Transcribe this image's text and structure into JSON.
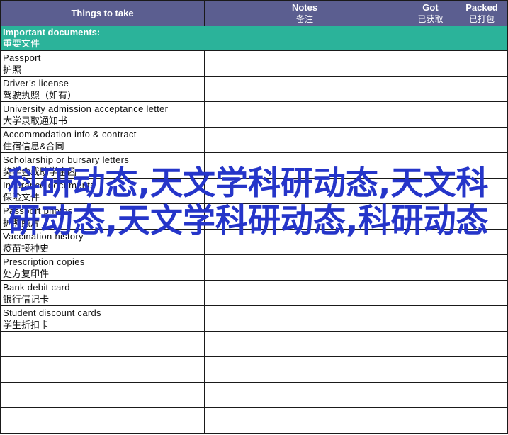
{
  "header": {
    "col1": "Things to take",
    "col2_en": "Notes",
    "col2_zh": "备注",
    "col3_en": "Got",
    "col3_zh": "已获取",
    "col4_en": "Packed",
    "col4_zh": "已打包"
  },
  "section": {
    "en": "Important documents:",
    "zh": "重要文件"
  },
  "items": [
    {
      "en": "Passport",
      "zh": "护照"
    },
    {
      "en": "Driver’s license",
      "zh": "驾驶执照（如有）"
    },
    {
      "en": "University admission acceptance letter",
      "zh": "大学录取通知书"
    },
    {
      "en": "Accommodation info & contract",
      "zh": "住宿信息&合同"
    },
    {
      "en": "Scholarship or bursary letters",
      "zh": "奖学金或助学金函"
    },
    {
      "en": "Insurance documents",
      "zh": "保险文件"
    },
    {
      "en": "Passport photos",
      "zh": "护照照片"
    },
    {
      "en": "Vaccination history",
      "zh": "疫苗接种史"
    },
    {
      "en": "Prescription copies",
      "zh": "处方复印件"
    },
    {
      "en": "Bank debit card",
      "zh": "银行借记卡"
    },
    {
      "en": "Student discount cards",
      "zh": "学生折扣卡"
    }
  ],
  "overlay_text": "科研动态,天文学科研动态,天文科研动态,天文学科研动态,科研动态",
  "colors": {
    "header_bg": "#5b5e90",
    "section_bg": "#2bb39a",
    "overlay": "#2535c9"
  }
}
